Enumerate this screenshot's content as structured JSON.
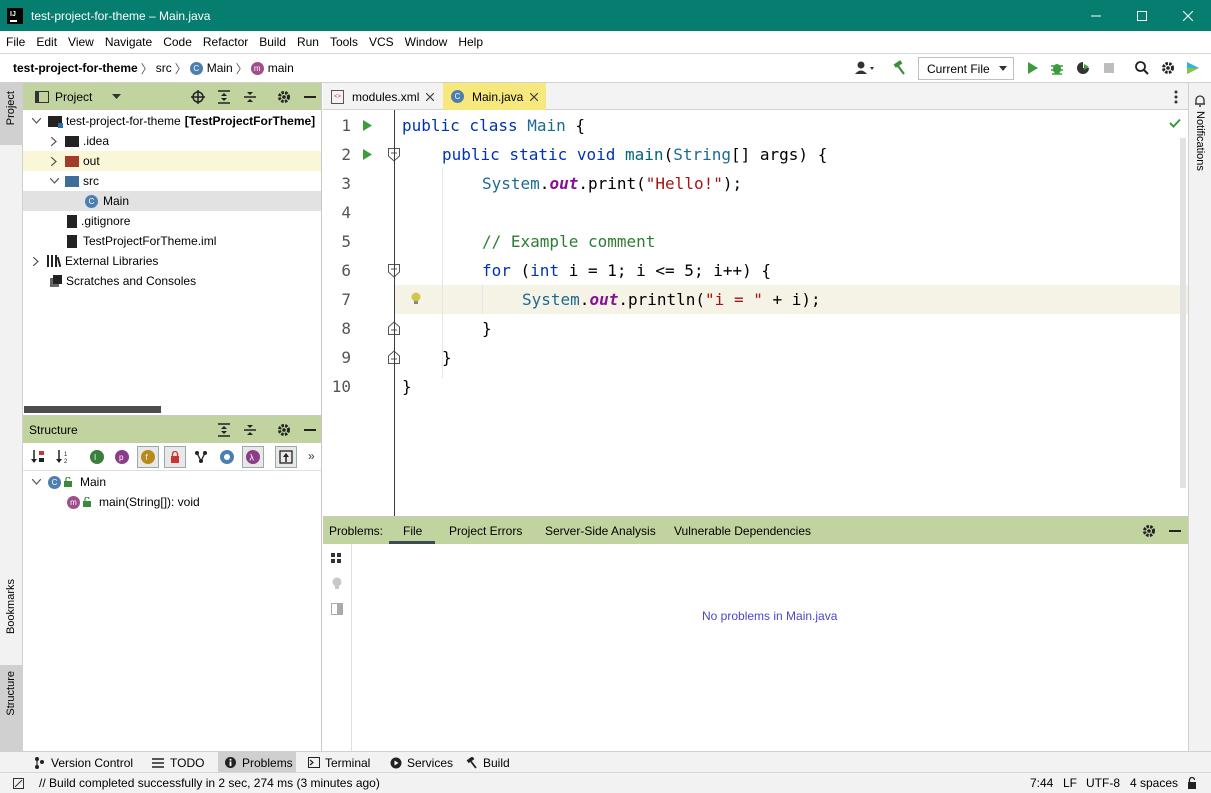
{
  "window": {
    "title": "test-project-for-theme – Main.java",
    "app_icon": "intellij-icon",
    "controls": [
      "minimize-icon",
      "maximize-icon",
      "close-icon"
    ]
  },
  "menu": [
    "File",
    "Edit",
    "View",
    "Navigate",
    "Code",
    "Refactor",
    "Build",
    "Run",
    "Tools",
    "VCS",
    "Window",
    "Help"
  ],
  "breadcrumb": {
    "project": "test-project-for-theme",
    "folder": "src",
    "class": "Main",
    "method": "main"
  },
  "run_config": {
    "label": "Current File"
  },
  "left_strip": {
    "project": "Project",
    "bookmarks": "Bookmarks",
    "structure": "Structure"
  },
  "right_strip": {
    "notifications": "Notifications"
  },
  "project_panel": {
    "title": "Project",
    "tree": [
      {
        "label": "test-project-for-theme",
        "suffix": "[TestProjectForTheme]"
      },
      {
        "label": ".idea"
      },
      {
        "label": "out"
      },
      {
        "label": "src"
      },
      {
        "label": "Main"
      },
      {
        "label": ".gitignore"
      },
      {
        "label": "TestProjectForTheme.iml"
      },
      {
        "label": "External Libraries"
      },
      {
        "label": "Scratches and Consoles"
      }
    ]
  },
  "structure_panel": {
    "title": "Structure",
    "tree": [
      {
        "label": "Main"
      },
      {
        "label": "main(String[]): void"
      }
    ]
  },
  "editor_tabs": [
    {
      "label": "modules.xml",
      "active": false
    },
    {
      "label": "Main.java",
      "active": true
    }
  ],
  "editor": {
    "lines": [
      "1",
      "2",
      "3",
      "4",
      "5",
      "6",
      "7",
      "8",
      "9",
      "10"
    ],
    "code": {
      "l1_kw": "public class",
      "l1_name": "Main",
      "l1_brace": "{",
      "l2_kw": "public static void",
      "l2_name": "main",
      "l2_paren": "(",
      "l2_type": "String",
      "l2_rest": "[] args) {",
      "l3_sys": "System",
      "l3_dot": ".",
      "l3_out": "out",
      "l3_call": ".print(",
      "l3_str": "\"Hello!\"",
      "l3_end": ");",
      "l5_cmt": "// Example comment",
      "l6_for": "for",
      "l6_p": " (",
      "l6_int": "int",
      "l6_rest": " i = 1; i <= 5; i++) {",
      "l7_sys": "System",
      "l7_dot": ".",
      "l7_out": "out",
      "l7_call": ".println(",
      "l7_str": "\"i = \"",
      "l7_end": " + i);",
      "l8": "}",
      "l9": "}",
      "l10": "}"
    }
  },
  "problems": {
    "label": "Problems:",
    "tabs": [
      "File",
      "Project Errors",
      "Server-Side Analysis",
      "Vulnerable Dependencies"
    ],
    "active_tab": "File",
    "empty_message": "No problems in Main.java"
  },
  "bottom_tools": [
    "Version Control",
    "TODO",
    "Problems",
    "Terminal",
    "Services",
    "Build"
  ],
  "status": {
    "message": "Build completed successfully in 2 sec, 274 ms (3 minutes ago)",
    "position": "7:44",
    "line_sep": "LF",
    "encoding": "UTF-8",
    "indent": "4 spaces"
  },
  "colors": {
    "title_bar": "#057e6f",
    "tool_header": "#c1d49f",
    "active_tab": "#f6e87c",
    "highlight_line": "#f5f3e6"
  }
}
